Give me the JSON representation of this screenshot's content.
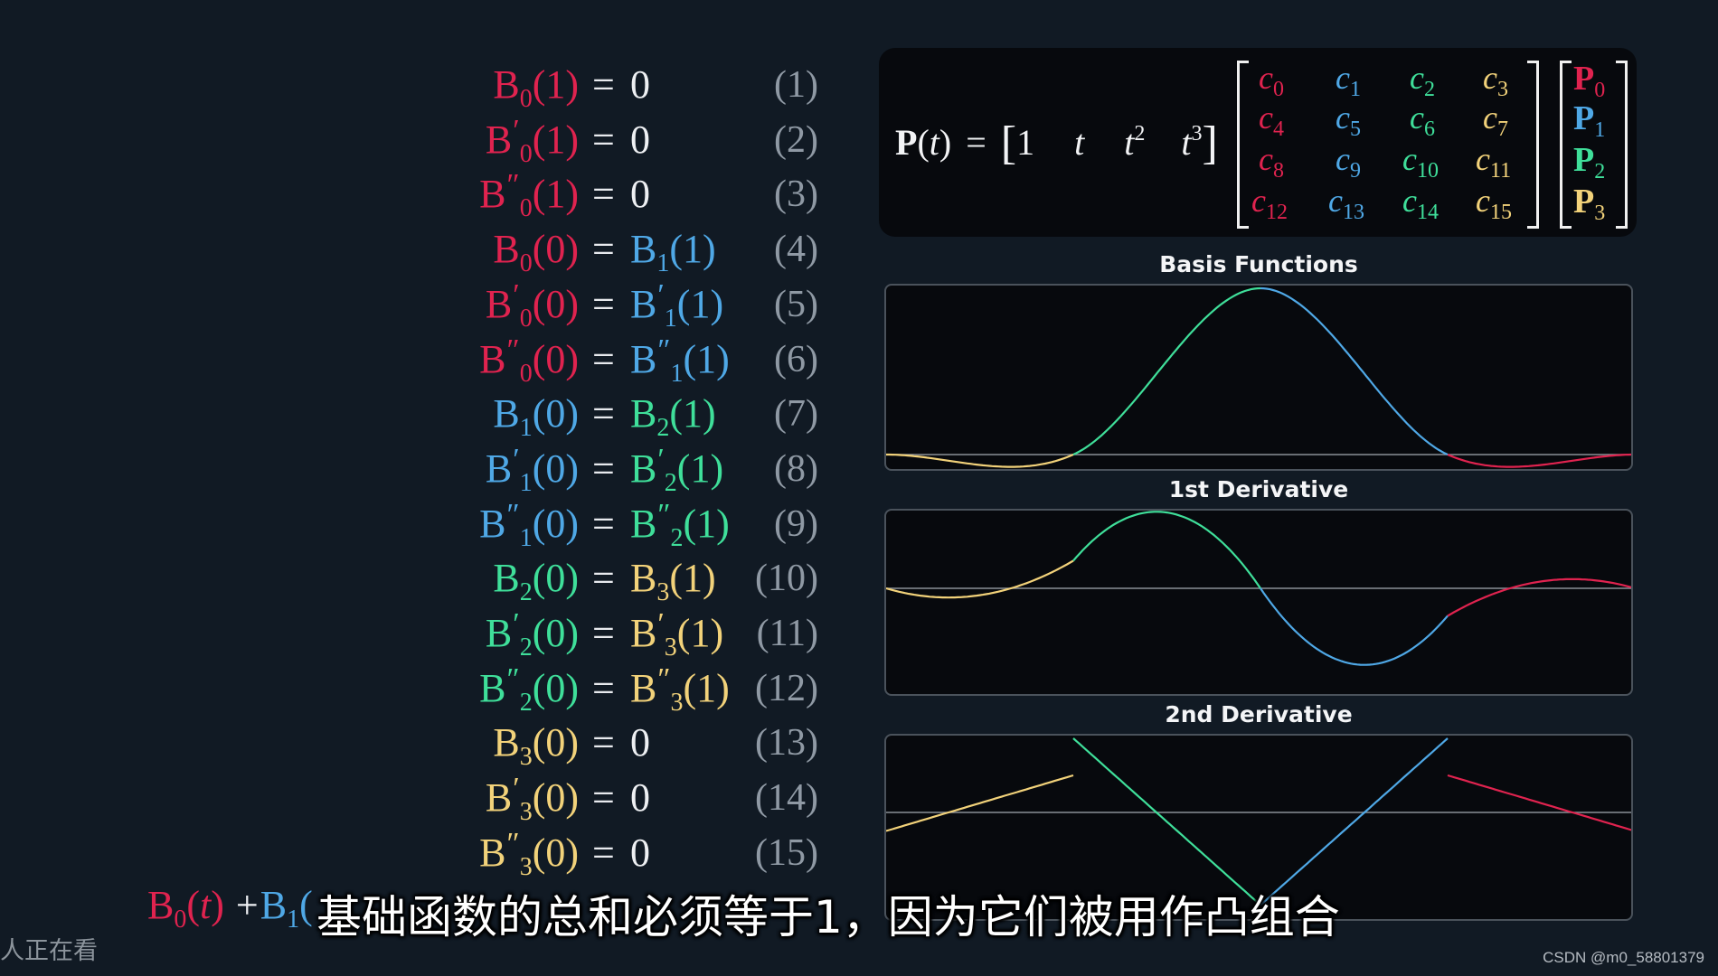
{
  "colors": {
    "B0": "#e0234f",
    "B1": "#4fa8e6",
    "B2": "#3fdf9a",
    "B3": "#f2d27a",
    "background": "#111a24",
    "panel": "#07090d",
    "axis": "#8a8f96"
  },
  "equations": [
    {
      "lhs": [
        {
          "base": "B",
          "prime": "",
          "sub": "0",
          "arg": "(1)",
          "color": "c-red"
        }
      ],
      "rhs": [
        {
          "text": "0",
          "color": "c-white"
        }
      ],
      "number": "(1)"
    },
    {
      "lhs": [
        {
          "base": "B",
          "prime": "′",
          "sub": "0",
          "arg": "(1)",
          "color": "c-red"
        }
      ],
      "rhs": [
        {
          "text": "0",
          "color": "c-white"
        }
      ],
      "number": "(2)"
    },
    {
      "lhs": [
        {
          "base": "B",
          "prime": "″",
          "sub": "0",
          "arg": "(1)",
          "color": "c-red"
        }
      ],
      "rhs": [
        {
          "text": "0",
          "color": "c-white"
        }
      ],
      "number": "(3)"
    },
    {
      "lhs": [
        {
          "base": "B",
          "prime": "",
          "sub": "0",
          "arg": "(0)",
          "color": "c-red"
        }
      ],
      "rhs": [
        {
          "base": "B",
          "prime": "",
          "sub": "1",
          "arg": "(1)",
          "color": "c-blue"
        }
      ],
      "number": "(4)"
    },
    {
      "lhs": [
        {
          "base": "B",
          "prime": "′",
          "sub": "0",
          "arg": "(0)",
          "color": "c-red"
        }
      ],
      "rhs": [
        {
          "base": "B",
          "prime": "′",
          "sub": "1",
          "arg": "(1)",
          "color": "c-blue"
        }
      ],
      "number": "(5)"
    },
    {
      "lhs": [
        {
          "base": "B",
          "prime": "″",
          "sub": "0",
          "arg": "(0)",
          "color": "c-red"
        }
      ],
      "rhs": [
        {
          "base": "B",
          "prime": "″",
          "sub": "1",
          "arg": "(1)",
          "color": "c-blue"
        }
      ],
      "number": "(6)"
    },
    {
      "lhs": [
        {
          "base": "B",
          "prime": "",
          "sub": "1",
          "arg": "(0)",
          "color": "c-blue"
        }
      ],
      "rhs": [
        {
          "base": "B",
          "prime": "",
          "sub": "2",
          "arg": "(1)",
          "color": "c-green"
        }
      ],
      "number": "(7)"
    },
    {
      "lhs": [
        {
          "base": "B",
          "prime": "′",
          "sub": "1",
          "arg": "(0)",
          "color": "c-blue"
        }
      ],
      "rhs": [
        {
          "base": "B",
          "prime": "′",
          "sub": "2",
          "arg": "(1)",
          "color": "c-green"
        }
      ],
      "number": "(8)"
    },
    {
      "lhs": [
        {
          "base": "B",
          "prime": "″",
          "sub": "1",
          "arg": "(0)",
          "color": "c-blue"
        }
      ],
      "rhs": [
        {
          "base": "B",
          "prime": "″",
          "sub": "2",
          "arg": "(1)",
          "color": "c-green"
        }
      ],
      "number": "(9)"
    },
    {
      "lhs": [
        {
          "base": "B",
          "prime": "",
          "sub": "2",
          "arg": "(0)",
          "color": "c-green"
        }
      ],
      "rhs": [
        {
          "base": "B",
          "prime": "",
          "sub": "3",
          "arg": "(1)",
          "color": "c-yellow"
        }
      ],
      "number": "(10)"
    },
    {
      "lhs": [
        {
          "base": "B",
          "prime": "′",
          "sub": "2",
          "arg": "(0)",
          "color": "c-green"
        }
      ],
      "rhs": [
        {
          "base": "B",
          "prime": "′",
          "sub": "3",
          "arg": "(1)",
          "color": "c-yellow"
        }
      ],
      "number": "(11)"
    },
    {
      "lhs": [
        {
          "base": "B",
          "prime": "″",
          "sub": "2",
          "arg": "(0)",
          "color": "c-green"
        }
      ],
      "rhs": [
        {
          "base": "B",
          "prime": "″",
          "sub": "3",
          "arg": "(1)",
          "color": "c-yellow"
        }
      ],
      "number": "(12)"
    },
    {
      "lhs": [
        {
          "base": "B",
          "prime": "",
          "sub": "3",
          "arg": "(0)",
          "color": "c-yellow"
        }
      ],
      "rhs": [
        {
          "text": "0",
          "color": "c-white"
        }
      ],
      "number": "(13)"
    },
    {
      "lhs": [
        {
          "base": "B",
          "prime": "′",
          "sub": "3",
          "arg": "(0)",
          "color": "c-yellow"
        }
      ],
      "rhs": [
        {
          "text": "0",
          "color": "c-white"
        }
      ],
      "number": "(14)"
    },
    {
      "lhs": [
        {
          "base": "B",
          "prime": "″",
          "sub": "3",
          "arg": "(0)",
          "color": "c-yellow"
        }
      ],
      "rhs": [
        {
          "text": "0",
          "color": "c-white"
        }
      ],
      "number": "(15)"
    }
  ],
  "equals_sign": "=",
  "matrix_formula": {
    "lhs_bold": "P",
    "lhs_paren_open": "(",
    "lhs_var": "t",
    "lhs_paren_close": ")",
    "equals": "=",
    "row_vector": [
      "1",
      "t",
      "t",
      "t"
    ],
    "row_vector_powers": [
      "",
      "",
      "2",
      "3"
    ],
    "coefficients": [
      [
        {
          "sub": "0",
          "color": "c-red"
        },
        {
          "sub": "1",
          "color": "c-blue"
        },
        {
          "sub": "2",
          "color": "c-green"
        },
        {
          "sub": "3",
          "color": "c-yellow"
        }
      ],
      [
        {
          "sub": "4",
          "color": "c-red"
        },
        {
          "sub": "5",
          "color": "c-blue"
        },
        {
          "sub": "6",
          "color": "c-green"
        },
        {
          "sub": "7",
          "color": "c-yellow"
        }
      ],
      [
        {
          "sub": "8",
          "color": "c-red"
        },
        {
          "sub": "9",
          "color": "c-blue"
        },
        {
          "sub": "10",
          "color": "c-green"
        },
        {
          "sub": "11",
          "color": "c-yellow"
        }
      ],
      [
        {
          "sub": "12",
          "color": "c-red"
        },
        {
          "sub": "13",
          "color": "c-blue"
        },
        {
          "sub": "14",
          "color": "c-green"
        },
        {
          "sub": "15",
          "color": "c-yellow"
        }
      ]
    ],
    "coef_symbol": "c",
    "points": [
      {
        "base": "P",
        "sub": "0",
        "color": "c-red"
      },
      {
        "base": "P",
        "sub": "1",
        "color": "c-blue"
      },
      {
        "base": "P",
        "sub": "2",
        "color": "c-green"
      },
      {
        "base": "P",
        "sub": "3",
        "color": "c-yellow"
      }
    ]
  },
  "chart_data": [
    {
      "type": "line",
      "title": "Basis Functions",
      "xlabel": "",
      "ylabel": "",
      "x_range": [
        0,
        4
      ],
      "ylim": [
        -0.13,
        1.0
      ],
      "zero_line": true,
      "series": [
        {
          "name": "B3",
          "segment": 0,
          "color": "#f2d27a",
          "formula": "0.5*(t^3 - t^2)",
          "min_value": -0.074
        },
        {
          "name": "B2",
          "segment": 1,
          "color": "#3fdf9a",
          "formula": "0.5*(t + 4t^2 - 3t^3)",
          "start": 0,
          "end": 1
        },
        {
          "name": "B1",
          "segment": 2,
          "color": "#4fa8e6",
          "formula": "0.5*(2 - 5t^2 + 3t^3)",
          "start": 1,
          "end": 0
        },
        {
          "name": "B0",
          "segment": 3,
          "color": "#e0234f",
          "formula": "0.5*(-t + 2t^2 - t^3)",
          "min_value": -0.074
        }
      ]
    },
    {
      "type": "line",
      "title": "1st Derivative",
      "xlabel": "",
      "ylabel": "",
      "x_range": [
        0,
        4
      ],
      "ylim": [
        -1.8,
        1.8
      ],
      "zero_line": true,
      "series": [
        {
          "name": "B3'",
          "segment": 0,
          "color": "#f2d27a",
          "formula": "0.5*(3t^2 - 2t)"
        },
        {
          "name": "B2'",
          "segment": 1,
          "color": "#3fdf9a",
          "formula": "0.5*(1 + 8t - 9t^2)"
        },
        {
          "name": "B1'",
          "segment": 2,
          "color": "#4fa8e6",
          "formula": "0.5*(-10t + 9t^2)"
        },
        {
          "name": "B0'",
          "segment": 3,
          "color": "#e0234f",
          "formula": "0.5*(-1 + 4t - 3t^2)"
        }
      ]
    },
    {
      "type": "line",
      "title": "2nd Derivative",
      "xlabel": "",
      "ylabel": "",
      "x_range": [
        0,
        4
      ],
      "ylim": [
        -6.0,
        6.0
      ],
      "zero_line": true,
      "series": [
        {
          "name": "B3''",
          "segment": 0,
          "color": "#f2d27a",
          "formula": "0.5*(6t - 2)"
        },
        {
          "name": "B2''",
          "segment": 1,
          "color": "#3fdf9a",
          "formula": "0.5*(8 - 18t)"
        },
        {
          "name": "B1''",
          "segment": 2,
          "color": "#4fa8e6",
          "formula": "0.5*(-10 + 18t)"
        },
        {
          "name": "B0''",
          "segment": 3,
          "color": "#e0234f",
          "formula": "0.5*(4 - 6t)"
        }
      ]
    }
  ],
  "bottom_formula": {
    "b0": "B",
    "b0_sub": "0",
    "b0_arg": "(t)",
    "plus": "+",
    "b1": "B",
    "b1_sub": "1",
    "b1_arg": "("
  },
  "subtitle": "基础函数的总和必须等于1，因为它们被用作凸组合",
  "watching_text": "人正在看",
  "watermark": "CSDN @m0_58801379"
}
